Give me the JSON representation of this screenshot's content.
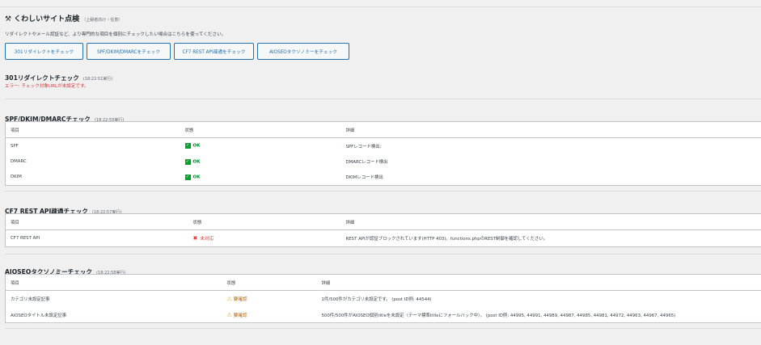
{
  "header": {
    "title": "くわしいサイト点検",
    "subtitle": "（上級者向け・任意）",
    "intro": "リダイレクトやメール認証など、より専門的な項目を個別にチェックしたい場合はこちらを使ってください。"
  },
  "buttons": [
    {
      "label": "301リダイレクトをチェック"
    },
    {
      "label": "SPF/DKIM/DMARCをチェック"
    },
    {
      "label": "CF7 REST API疎通をチェック"
    },
    {
      "label": "AIOSEOタクソノミーをチェック"
    }
  ],
  "redirect_check": {
    "title": "301リダイレクトチェック",
    "time": "(18:22:51実行)",
    "error": "エラー: チェック対象URLが未設定です。"
  },
  "spf_check": {
    "title": "SPF/DKIM/DMARCチェック",
    "time": "(18:22:55実行)",
    "headers": [
      "項目",
      "状態",
      "詳細"
    ],
    "rows": [
      {
        "item": "SPF",
        "status": "OK",
        "detail": "SPFレコード検出: "
      },
      {
        "item": "DMARC",
        "status": "OK",
        "detail": "DMARCレコード検出"
      },
      {
        "item": "DKIM",
        "status": "OK",
        "detail": "DKIMレコード検出"
      }
    ]
  },
  "cf7_check": {
    "title": "CF7 REST API疎通チェック",
    "time": "(18:22:57実行)",
    "headers": [
      "項目",
      "状態",
      "詳細"
    ],
    "rows": [
      {
        "item": "CF7 REST API",
        "status": "未対応",
        "detail": "REST APIが認証ブロックされています(HTTP 403)。functions.phpのREST制御を確認してください。"
      }
    ]
  },
  "aioseo_check": {
    "title": "AIOSEOタクソノミーチェック",
    "time": "(18:22:58実行)",
    "headers": [
      "項目",
      "状態",
      "詳細"
    ],
    "rows": [
      {
        "item": "カテゴリ未設定記事",
        "status": "要確認",
        "detail": "1件/500件がカテゴリ未設定です。 (post ID例: 44544)"
      },
      {
        "item": "AIOSEOタイトル未設定記事",
        "status": "要確認",
        "detail": "500件/500件がAIOSEO個別titleを未設定（テーマ標準titleにフォールバック中）。 (post ID例: 44995, 44991, 44989, 44987, 44985, 44981, 44972, 44963, 44967, 44965)"
      }
    ]
  },
  "colors": {
    "ok": "#00a32a",
    "error": "#d63638",
    "warning": "#dba617",
    "link": "#2271b1"
  },
  "icons": {
    "ok": "checkmark-box-icon",
    "ng": "x-mark-icon",
    "warn": "warning-triangle-icon",
    "tool": "tools-icon"
  }
}
